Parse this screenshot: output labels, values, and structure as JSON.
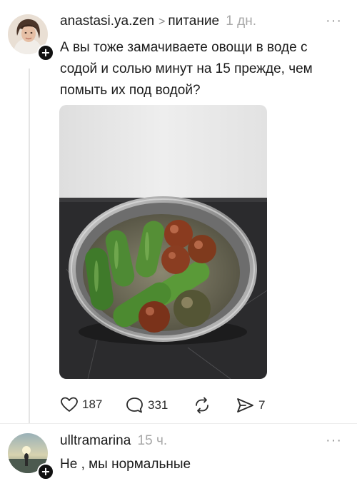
{
  "post": {
    "author": "anastasi.ya.zen",
    "separator": ">",
    "channel": "питание",
    "time": "1 дн.",
    "more": "···",
    "text": "А вы тоже замачиваете овощи в воде с содой и солью минут на 15 прежде, чем помыть их под водой?",
    "badge": "+",
    "photo_icon": "bowl-of-vegetables-photo"
  },
  "actions": {
    "likes": "187",
    "comments": "331",
    "reposts": "",
    "shares": "7",
    "like_icon": "heart-icon",
    "comment_icon": "speech-bubble-icon",
    "repost_icon": "repost-icon",
    "share_icon": "send-arrow-icon"
  },
  "comment": {
    "author": "ulltramarina",
    "time": "15 ч.",
    "more": "···",
    "text": "Не , мы нормальные",
    "badge": "+"
  }
}
